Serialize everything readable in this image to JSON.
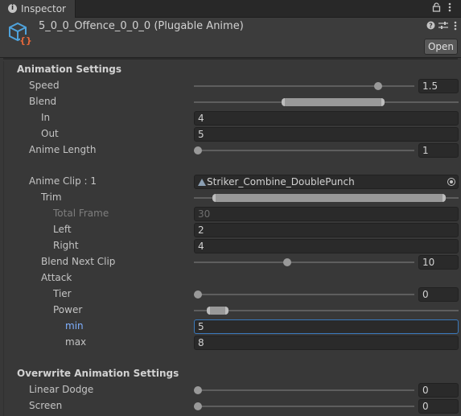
{
  "window": {
    "tab_label": "Inspector",
    "tab_icon": "info-icon",
    "lock_icon": "lock-icon",
    "menu_icon": "kebab-menu-icon"
  },
  "header": {
    "title": "5_0_0_Offence_0_0_0 (Plugable Anime)",
    "icon": "script-asset-icon",
    "open_label": "Open",
    "help_icon": "help-icon",
    "settings_icon": "preset-icon",
    "menu_icon": "kebab-menu-icon"
  },
  "animation_settings": {
    "heading": "Animation Settings",
    "speed": {
      "label": "Speed",
      "value": "1.5",
      "fraction": 0.85
    },
    "blend": {
      "label": "Blend",
      "range": [
        0.33,
        0.72
      ]
    },
    "in": {
      "label": "In",
      "value": "4"
    },
    "out": {
      "label": "Out",
      "value": "5"
    },
    "anime_length": {
      "label": "Anime Length",
      "value": "1",
      "fraction": 0.0
    }
  },
  "anime_clip": {
    "label": "Anime Clip : 1",
    "value": "Striker_Combine_DoublePunch",
    "trim": {
      "label": "Trim",
      "range": [
        0.07,
        0.95
      ]
    },
    "total_frame": {
      "label": "Total Frame",
      "value": "30"
    },
    "left": {
      "label": "Left",
      "value": "2"
    },
    "right": {
      "label": "Right",
      "value": "4"
    },
    "blend_next_clip": {
      "label": "Blend Next Clip",
      "value": "10",
      "fraction": 0.42
    },
    "attack": {
      "label": "Attack",
      "tier": {
        "label": "Tier",
        "value": "0",
        "fraction": 0.0
      },
      "power": {
        "label": "Power",
        "range": [
          0.05,
          0.13
        ]
      },
      "min": {
        "label": "min",
        "value": "5"
      },
      "max": {
        "label": "max",
        "value": "8"
      }
    }
  },
  "overwrite_settings": {
    "heading": "Overwrite Animation Settings",
    "linear_dodge": {
      "label": "Linear Dodge",
      "value": "0",
      "fraction": 0.0
    },
    "screen": {
      "label": "Screen",
      "value": "0",
      "fraction": 0.0
    }
  },
  "colors": {
    "background": "#383838",
    "header": "#3c3c3c",
    "field": "#2a2a2a",
    "focus": "#3a79bb",
    "selected_label": "#7fb0ff"
  }
}
